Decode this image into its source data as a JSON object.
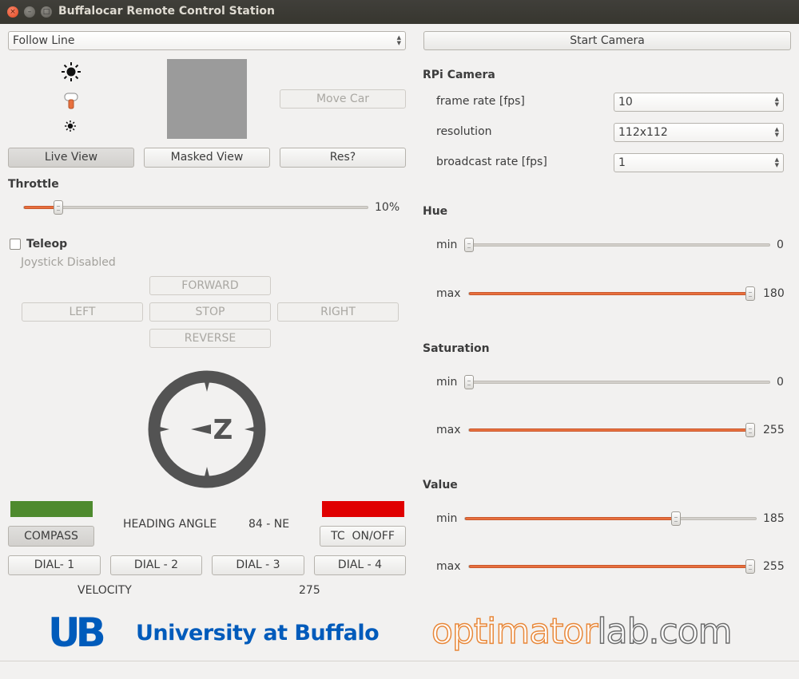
{
  "window": {
    "title": "Buffalocar Remote Control Station",
    "close_glyph": "×",
    "min_glyph": "–",
    "max_glyph": "□"
  },
  "mode_select": {
    "value": "Follow Line"
  },
  "camera": {
    "start_label": "Start Camera"
  },
  "left_buttons": {
    "move_car": "Move Car",
    "live_view": "Live View",
    "masked_view": "Masked View",
    "res": "Res?"
  },
  "icons": {
    "brightness_high": "sun-icon",
    "brightness_low": "small-sun-icon",
    "joystick": "joystick-icon"
  },
  "throttle": {
    "label": "Throttle",
    "value_text": "10%",
    "value": 0.1
  },
  "teleop": {
    "label": "Teleop",
    "status": "Joystick Disabled",
    "checked": false
  },
  "drive": {
    "forward": "FORWARD",
    "left": "LEFT",
    "stop": "STOP",
    "right": "RIGHT",
    "reverse": "REVERSE"
  },
  "compass": {
    "label": "COMPASS",
    "heading_label": "HEADING ANGLE",
    "heading_value": "84 - NE",
    "tc_label": "TC  ON/OFF",
    "status_left_color": "#4e8a2e",
    "status_right_color": "#e00000"
  },
  "dials": [
    "DIAL- 1",
    "DIAL - 2",
    "DIAL - 3",
    "DIAL - 4"
  ],
  "velocity": {
    "label": "VELOCITY",
    "value": "275"
  },
  "rpi_camera": {
    "heading": "RPi Camera",
    "frame_rate": {
      "label": "frame rate [fps]",
      "value": "10"
    },
    "resolution": {
      "label": "resolution",
      "value": "112x112"
    },
    "broadcast_rate": {
      "label": "broadcast rate [fps]",
      "value": "1"
    }
  },
  "hue": {
    "heading": "Hue",
    "min_label": "min",
    "min_value": "0",
    "max_label": "max",
    "max_value": "180",
    "range_max": 180
  },
  "saturation": {
    "heading": "Saturation",
    "min_label": "min",
    "min_value": "0",
    "max_label": "max",
    "max_value": "255",
    "range_max": 255
  },
  "value_hsv": {
    "heading": "Value",
    "min_label": "min",
    "min_value": "185",
    "max_label": "max",
    "max_value": "255",
    "range_max": 255
  },
  "logos": {
    "ub_text": "University at Buffalo",
    "optimator_a": "optimator",
    "optimator_b": "lab.com",
    "ub_mark": "UB",
    "compass_mark": "Z"
  }
}
